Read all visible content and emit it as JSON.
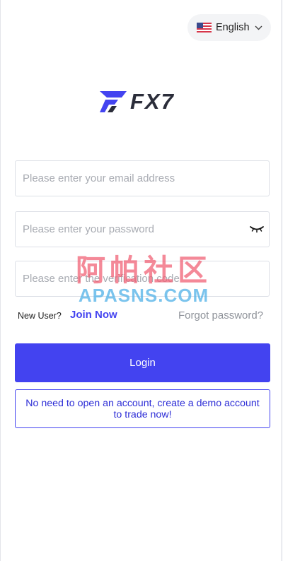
{
  "language": {
    "label": "English",
    "flag_icon": "us-flag-icon"
  },
  "logo": {
    "text": "FX7"
  },
  "form": {
    "email_placeholder": "Please enter your email address",
    "password_placeholder": "Please enter your password",
    "code_placeholder": "Please enter the verification code",
    "password_toggle_icon": "eye-closed-icon"
  },
  "links": {
    "new_user": "New User?",
    "join_now": "Join Now",
    "forgot_password": "Forgot password?"
  },
  "buttons": {
    "login": "Login",
    "demo": "No need to open an account, create a demo account to trade now!"
  },
  "watermark": {
    "top": "阿帕社区",
    "bottom": "APASNS.COM"
  },
  "colors": {
    "accent": "#4343f0",
    "logo_dark": "#2b2d3a",
    "muted_text": "#8f939a",
    "placeholder": "#a8abb2"
  }
}
